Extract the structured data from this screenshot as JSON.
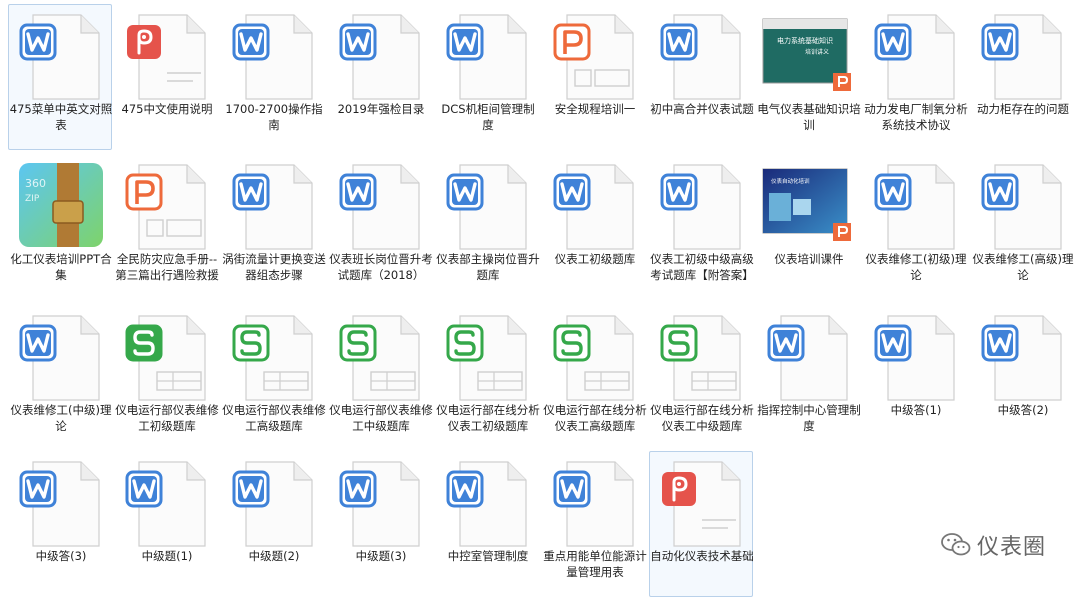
{
  "files": [
    {
      "label": "475菜单中英文对照表",
      "type": "doc",
      "selected": true
    },
    {
      "label": "475中文使用说明",
      "type": "pdf"
    },
    {
      "label": "1700-2700操作指南",
      "type": "doc"
    },
    {
      "label": "2019年强检目录",
      "type": "doc"
    },
    {
      "label": "DCS机柜间管理制度",
      "type": "doc"
    },
    {
      "label": "安全规程培训一",
      "type": "ppt"
    },
    {
      "label": "初中高合并仪表试题",
      "type": "doc"
    },
    {
      "label": "电气仪表基础知识培训",
      "type": "pptimg",
      "img_title": "电力系统基础知识 培训讲义"
    },
    {
      "label": "动力发电厂制氧分析系统技术协议",
      "type": "doc"
    },
    {
      "label": "动力柜存在的问题",
      "type": "doc"
    },
    {
      "label": "化工仪表培训PPT合集",
      "type": "zip",
      "zip_text": "360 ZIP"
    },
    {
      "label": "全民防灾应急手册--第三篇出行遇险救援",
      "type": "ppt"
    },
    {
      "label": "涡街流量计更换变送器组态步骤",
      "type": "doc"
    },
    {
      "label": "仪表班长岗位晋升考试题库（2018）",
      "type": "doc"
    },
    {
      "label": "仪表部主操岗位晋升题库",
      "type": "doc"
    },
    {
      "label": "仪表工初级题库",
      "type": "doc"
    },
    {
      "label": "仪表工初级中级高级考试题库【附答案】",
      "type": "doc"
    },
    {
      "label": "仪表培训课件",
      "type": "pptimg2",
      "img_title": "仪表自动化培训"
    },
    {
      "label": "仪表维修工(初级)理论",
      "type": "doc"
    },
    {
      "label": "仪表维修工(高级)理论",
      "type": "doc"
    },
    {
      "label": "仪表维修工(中级)理论",
      "type": "doc"
    },
    {
      "label": "仪电运行部仪表维修工初级题库",
      "type": "xls"
    },
    {
      "label": "仪电运行部仪表维修工高级题库",
      "type": "xls2"
    },
    {
      "label": "仪电运行部仪表维修工中级题库",
      "type": "xls2"
    },
    {
      "label": "仪电运行部在线分析仪表工初级题库",
      "type": "xls2"
    },
    {
      "label": "仪电运行部在线分析仪表工高级题库",
      "type": "xls2"
    },
    {
      "label": "仪电运行部在线分析仪表工中级题库",
      "type": "xls2"
    },
    {
      "label": "指挥控制中心管理制度",
      "type": "doc"
    },
    {
      "label": "中级答(1)",
      "type": "doc"
    },
    {
      "label": "中级答(2)",
      "type": "doc"
    },
    {
      "label": "中级答(3)",
      "type": "doc"
    },
    {
      "label": "中级题(1)",
      "type": "doc"
    },
    {
      "label": "中级题(2)",
      "type": "doc"
    },
    {
      "label": "中级题(3)",
      "type": "doc"
    },
    {
      "label": "中控室管理制度",
      "type": "doc"
    },
    {
      "label": "重点用能单位能源计量管理用表",
      "type": "doc"
    },
    {
      "label": "自动化仪表技术基础",
      "type": "pdf",
      "selected": true
    }
  ],
  "watermark": {
    "text": "仪表圈"
  },
  "colors": {
    "doc": "#3f82d8",
    "pdf": "#e5534b",
    "ppt": "#ee6a3b",
    "xls": "#35a84a",
    "selected_border": "#b9d1ea"
  }
}
